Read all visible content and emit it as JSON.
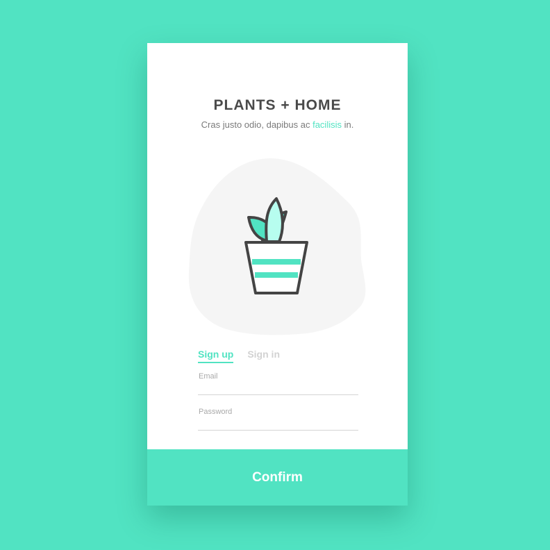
{
  "colors": {
    "background": "#51e3c2",
    "accent": "#51e3c2",
    "card": "#ffffff",
    "title": "#4a4a4a",
    "illustration_blob": "#f5f5f5",
    "illustration_stroke": "#444444",
    "leaf_light": "#b7fdef"
  },
  "header": {
    "title": "PLANTS + HOME",
    "subtitle_before": "Cras justo odio, dapibus ac ",
    "subtitle_link": "facilisis",
    "subtitle_after": " in."
  },
  "illustration": {
    "icon": "potted-plant-icon"
  },
  "tabs": [
    {
      "label": "Sign up",
      "active": true
    },
    {
      "label": "Sign in",
      "active": false
    }
  ],
  "form": {
    "email": {
      "label": "Email",
      "value": ""
    },
    "password": {
      "label": "Password",
      "value": ""
    }
  },
  "actions": {
    "confirm_label": "Confirm"
  }
}
